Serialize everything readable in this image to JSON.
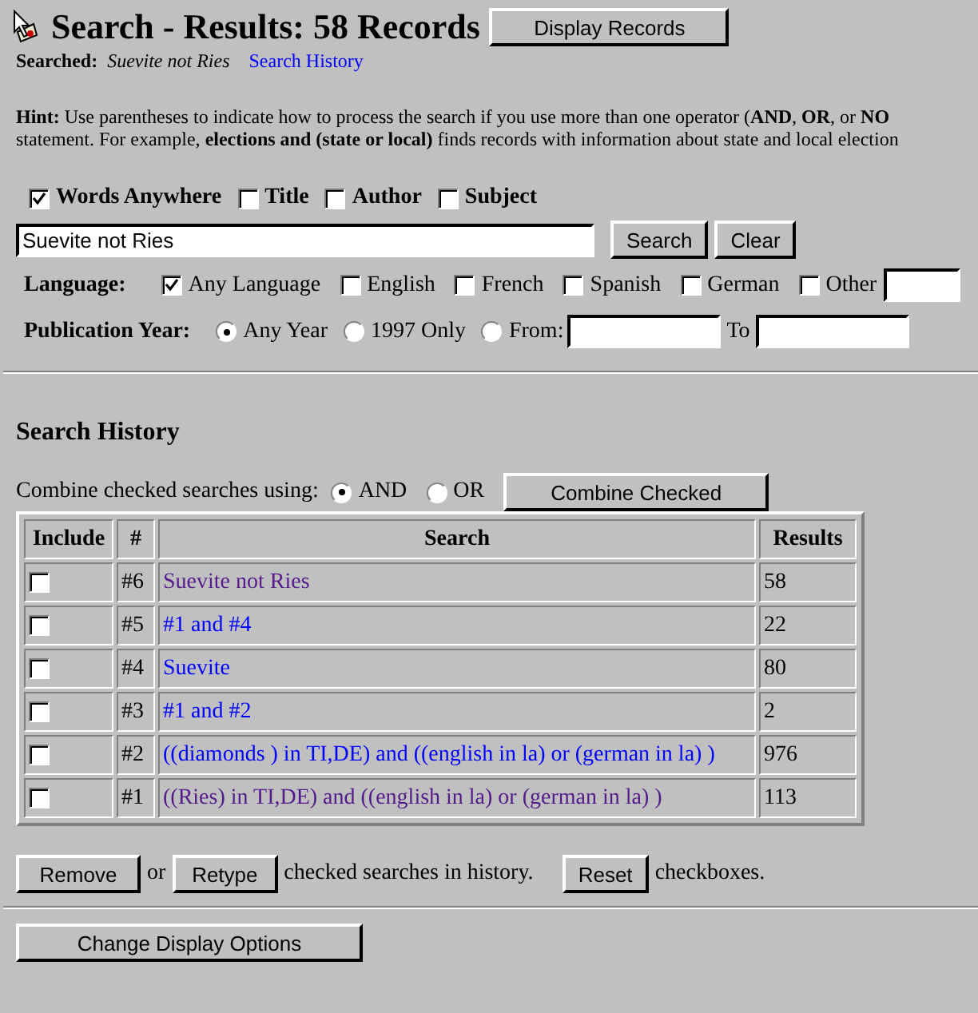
{
  "header": {
    "title": "Search - Results: 58 Records",
    "display_button": "Display Records",
    "searched_label": "Searched:",
    "searched_value": "Suevite not Ries",
    "history_link": "Search History"
  },
  "hint": {
    "line_1": "**Hint:** Use parentheses to indicate how to process the search if you use more than one operator (**AND**, **OR**, or **NO**",
    "line_2": "statement. For example, **elections and (state or local)** finds records with information about state and local election"
  },
  "fields": [
    {
      "label": "Words Anywhere",
      "checked": true
    },
    {
      "label": "Title",
      "checked": false
    },
    {
      "label": "Author",
      "checked": false
    },
    {
      "label": "Subject",
      "checked": false
    }
  ],
  "search_field": {
    "value": "Suevite not Ries"
  },
  "search_buttons": [
    "Search",
    "Clear"
  ],
  "language": {
    "label": "Language:",
    "options": [
      {
        "label": "Any Language",
        "checked": true
      },
      {
        "label": "English",
        "checked": false
      },
      {
        "label": "French",
        "checked": false
      },
      {
        "label": "Spanish",
        "checked": false
      },
      {
        "label": "German",
        "checked": false
      },
      {
        "label": "Other",
        "checked": false
      }
    ]
  },
  "publication_year": {
    "label": "Publication Year:",
    "options": [
      {
        "label": "Any Year",
        "selected": true
      },
      {
        "label": "1997 Only",
        "selected": false
      },
      {
        "label": "From:",
        "selected": false
      }
    ],
    "to_label": "To"
  },
  "history": {
    "title": "Search History",
    "combine_label": "Combine checked searches using:",
    "operators": [
      {
        "label": "AND",
        "selected": true
      },
      {
        "label": "OR",
        "selected": false
      }
    ],
    "combine_button": "Combine Checked",
    "columns": [
      "Include",
      "#",
      "Search",
      "Results"
    ],
    "rows": [
      {
        "checked": false,
        "number": "#6",
        "search": "Suevite not Ries",
        "visited": true,
        "results": "58"
      },
      {
        "checked": false,
        "number": "#5",
        "search": "#1 and #4",
        "visited": false,
        "results": "22"
      },
      {
        "checked": false,
        "number": "#4",
        "search": "Suevite",
        "visited": false,
        "results": "80"
      },
      {
        "checked": false,
        "number": "#3",
        "search": "#1 and #2",
        "visited": false,
        "results": "2"
      },
      {
        "checked": false,
        "number": "#2",
        "search": "((diamonds ) in TI,DE) and ((english in la) or (german in la) )",
        "visited": false,
        "results": "976"
      },
      {
        "checked": false,
        "number": "#1",
        "search": "((Ries) in TI,DE) and ((english in la) or (german in la) )",
        "visited": true,
        "results": "113"
      }
    ]
  },
  "actions": {
    "remove": "Remove",
    "or": "or",
    "retype": "Retype",
    "text_1": "checked searches in history.",
    "reset": "Reset",
    "text_2": "checkboxes."
  },
  "display_options_button": "Change Display Options"
}
